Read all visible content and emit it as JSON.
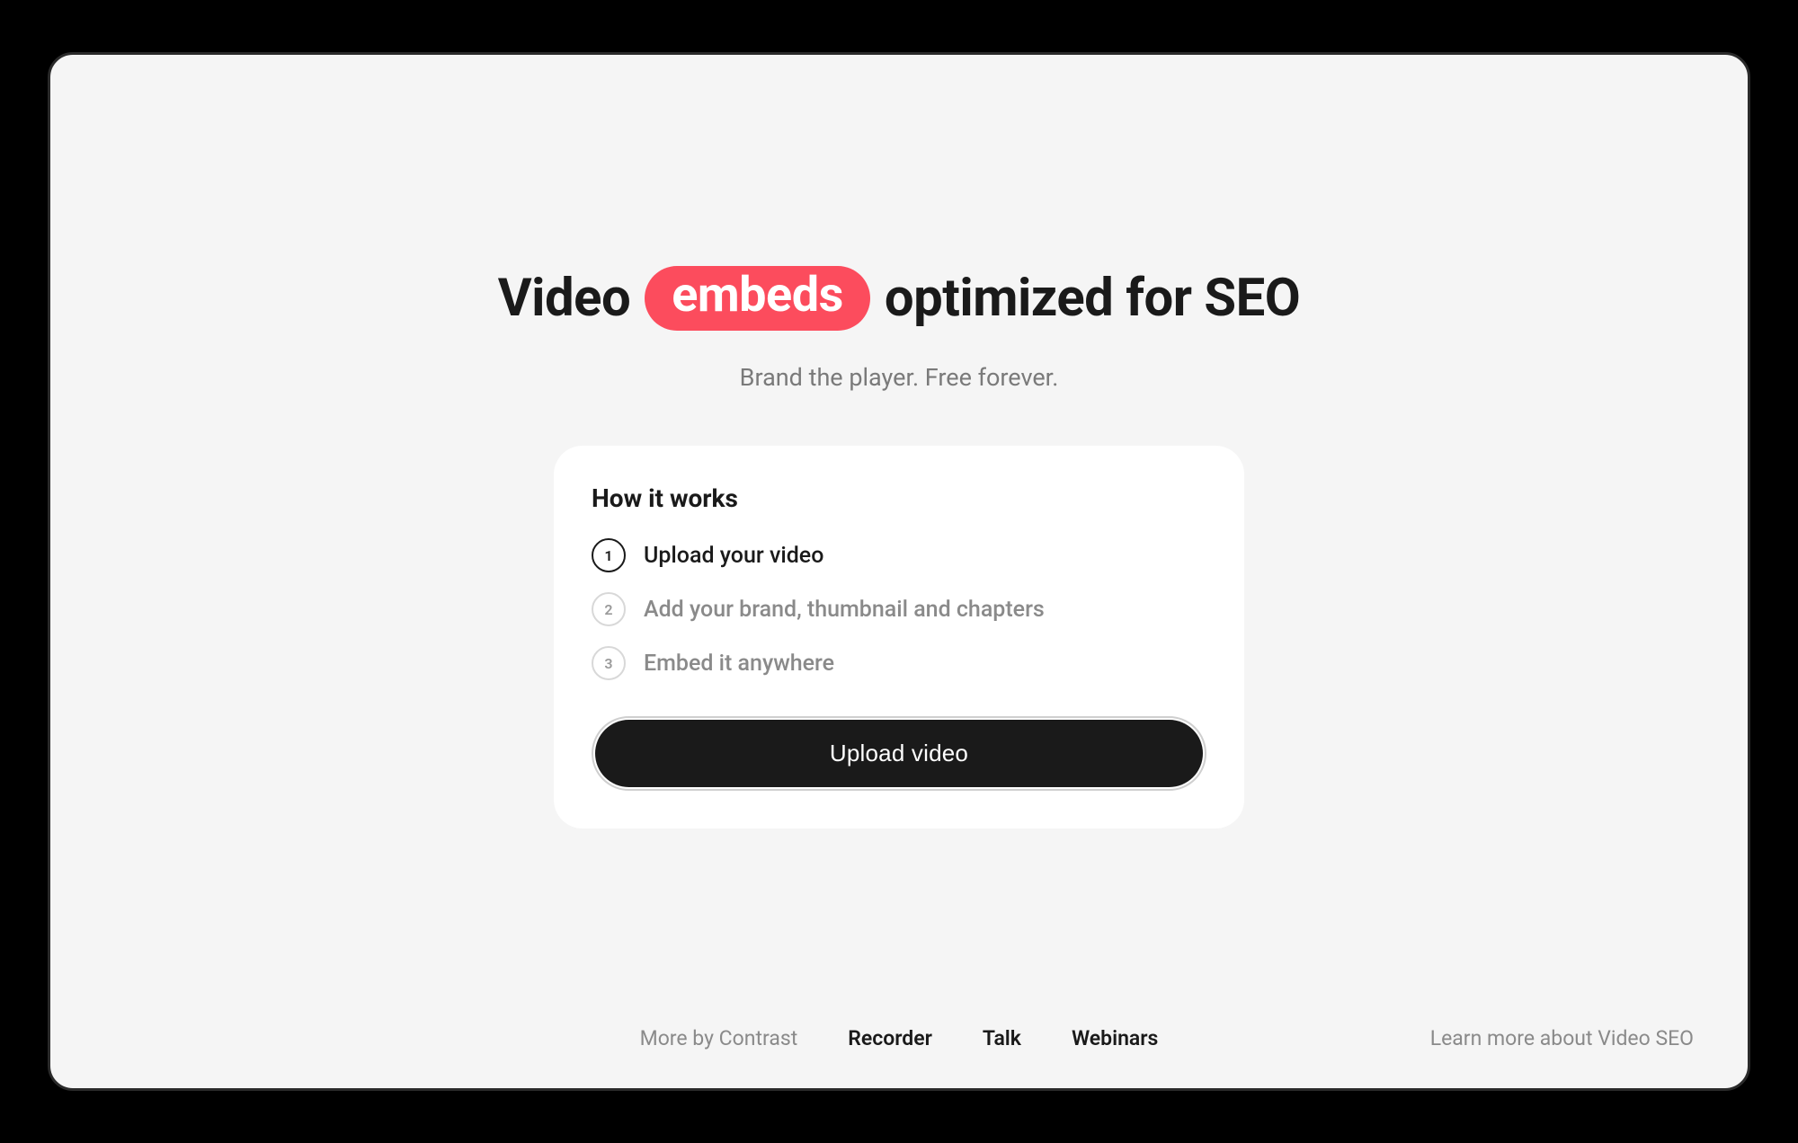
{
  "hero": {
    "title_pre": "Video",
    "title_pill": "embeds",
    "title_post": "optimized for SEO",
    "subtitle": "Brand the player. Free forever."
  },
  "card": {
    "title": "How it works",
    "steps": [
      {
        "num": "1",
        "label": "Upload your video",
        "active": true
      },
      {
        "num": "2",
        "label": "Add your brand, thumbnail and chapters",
        "active": false
      },
      {
        "num": "3",
        "label": "Embed it anywhere",
        "active": false
      }
    ],
    "cta_label": "Upload video"
  },
  "footer": {
    "label": "More by Contrast",
    "links": [
      "Recorder",
      "Talk",
      "Webinars"
    ],
    "right": "Learn more about Video SEO"
  },
  "colors": {
    "accent": "#fc4c5d",
    "bg": "#f5f5f5",
    "card": "#ffffff",
    "text": "#1a1a1a",
    "muted": "#8a8a8a"
  }
}
